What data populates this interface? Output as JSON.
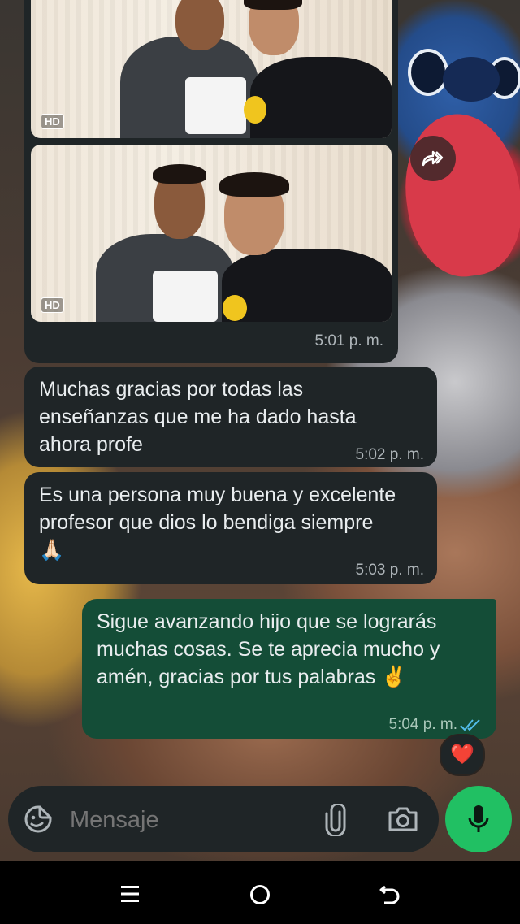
{
  "chat": {
    "images": [
      {
        "badge": "HD"
      },
      {
        "badge": "HD"
      }
    ],
    "image_group_time": "5:01 p. m.",
    "messages": [
      {
        "direction": "incoming",
        "text": "Muchas gracias por todas las enseñanzas que me ha dado hasta ahora profe",
        "time": "5:02 p. m."
      },
      {
        "direction": "incoming",
        "text": "Es una persona muy buena y excelente profesor que dios lo bendiga siempre🙏🏻",
        "time": "5:03 p. m."
      },
      {
        "direction": "outgoing",
        "text": "Sigue avanzando hijo que se lograrás muchas cosas. Se te aprecia mucho y amén, gracias por tus palabras ✌️",
        "time": "5:04 p. m.",
        "status": "read-double-check"
      }
    ],
    "reaction": "❤️"
  },
  "composer": {
    "placeholder": "Mensaje",
    "icons": [
      "emoji-sticker-icon",
      "attach-icon",
      "camera-icon"
    ],
    "mic_icon": "microphone-icon"
  },
  "colors": {
    "incoming_bubble": "#1f2527",
    "outgoing_bubble": "#144d37",
    "accent": "#21c063",
    "read_tick": "#53bdeb"
  },
  "navbar": {
    "icons": [
      "recent-apps-icon",
      "home-icon",
      "back-icon"
    ]
  }
}
